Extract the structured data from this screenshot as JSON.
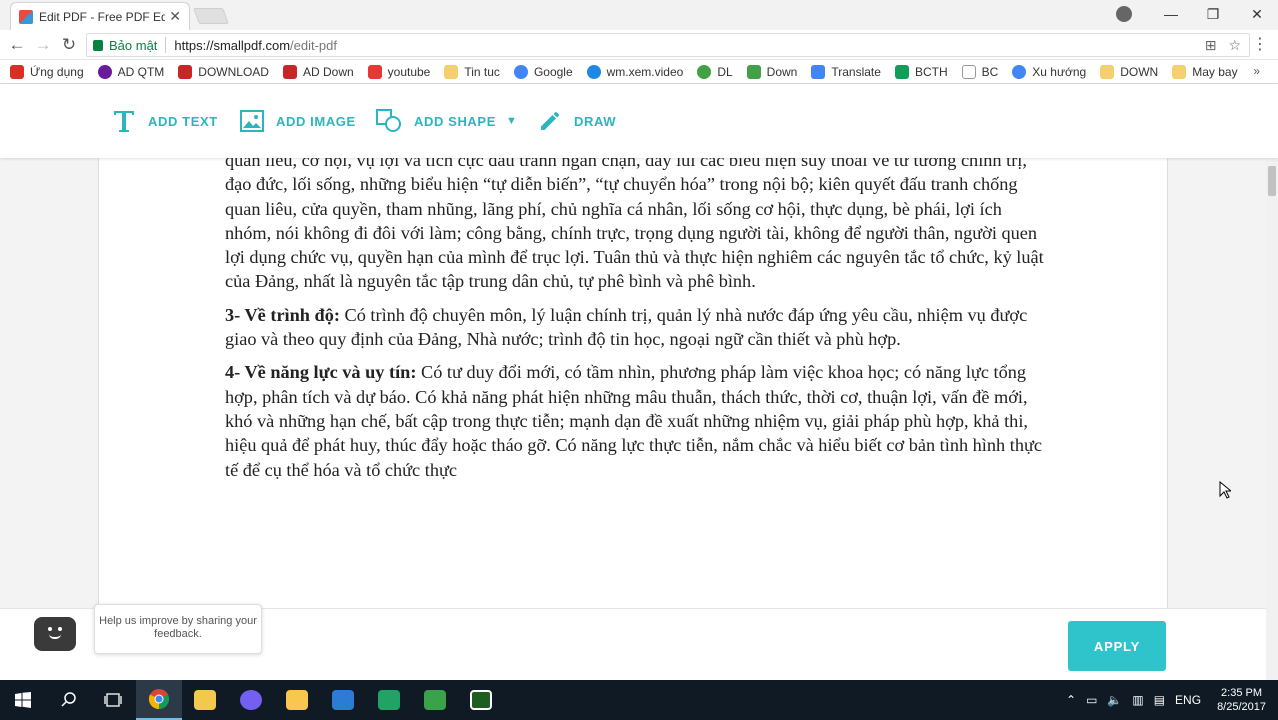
{
  "browser": {
    "tab_title": "Edit PDF - Free PDF Edito",
    "secure_label": "Bảo mật",
    "url_host": "https://smallpdf.com",
    "url_path": "/edit-pdf",
    "bookmarks": [
      {
        "label": "Ứng dụng",
        "color": "#d93025"
      },
      {
        "label": "AD QTM",
        "color": "#6a1b9a"
      },
      {
        "label": "DOWNLOAD",
        "color": "#c62828"
      },
      {
        "label": "AD Down",
        "color": "#c62828"
      },
      {
        "label": "youtube",
        "color": "#e53935"
      },
      {
        "label": "Tin tuc",
        "color": "#f4d06f"
      },
      {
        "label": "Google",
        "color": "#4285f4"
      },
      {
        "label": "wm.xem.video",
        "color": "#1e88e5"
      },
      {
        "label": "DL",
        "color": "#43a047"
      },
      {
        "label": "Down",
        "color": "#43a047"
      },
      {
        "label": "Translate",
        "color": "#4285f4"
      },
      {
        "label": "BCTH",
        "color": "#0f9d58"
      },
      {
        "label": "BC",
        "color": "#9e9e9e"
      },
      {
        "label": "Xu hướng",
        "color": "#4285f4"
      },
      {
        "label": "DOWN",
        "color": "#f4d06f"
      },
      {
        "label": "May bay",
        "color": "#f4d06f"
      }
    ]
  },
  "editor": {
    "tools": [
      {
        "label": "ADD TEXT",
        "icon": "text-icon"
      },
      {
        "label": "ADD IMAGE",
        "icon": "image-icon"
      },
      {
        "label": "ADD SHAPE",
        "icon": "shape-icon"
      },
      {
        "label": "DRAW",
        "icon": "pencil-icon"
      }
    ],
    "accent": "#2db5bf"
  },
  "document": {
    "para1": "quan liêu, cơ hội, vụ lợi và tích cực đấu tranh ngăn chặn, đẩy lùi các biểu hiện suy thoái về tư tưởng chính trị, đạo đức, lối sống, những biểu hiện “tự diễn biến”, “tự chuyển hóa” trong nội bộ; kiên quyết đấu tranh chống quan liêu, cửa quyền, tham nhũng, lãng phí, chủ nghĩa cá nhân, lối sống cơ hội, thực dụng, bè phái, lợi ích nhóm, nói không đi đôi với làm; công bằng, chính trực, trọng dụng người tài, không để người thân, người quen lợi dụng chức vụ, quyền hạn của mình để trục lợi. Tuân thủ và thực hiện nghiêm các nguyên tắc tổ chức, kỷ luật của Đảng, nhất là nguyên tắc tập trung dân chủ, tự phê bình và phê bình.",
    "para2_head": "3- Về trình độ:",
    "para2_body": " Có trình độ chuyên môn, lý luận chính trị, quản lý nhà nước đáp ứng yêu cầu, nhiệm vụ được giao và theo quy định của Đảng, Nhà nước; trình độ tin học, ngoại ngữ cần thiết và phù hợp.",
    "para3_head": "4- Về năng lực và uy tín:",
    "para3_body": " Có tư duy đổi mới, có tầm nhìn, phương pháp làm việc khoa học; có năng lực tổng hợp, phân tích và dự báo. Có khả năng phát hiện những mâu thuẫn, thách thức, thời cơ, thuận lợi, vấn đề mới, khó và những hạn chế, bất cập trong thực tiễn; mạnh dạn đề xuất những nhiệm vụ, giải pháp phù hợp, khả thi, hiệu quả để phát huy, thúc đẩy hoặc tháo gỡ. Có năng lực thực tiễn, nắm chắc và hiểu biết cơ bản tình hình thực tế để cụ thể hóa và tổ chức thực"
  },
  "bottom": {
    "feedback": "Help us improve by sharing your feedback.",
    "apply_label": "APPLY"
  },
  "taskbar": {
    "lang": "ENG",
    "time": "2:35 PM",
    "date": "8/25/2017"
  }
}
